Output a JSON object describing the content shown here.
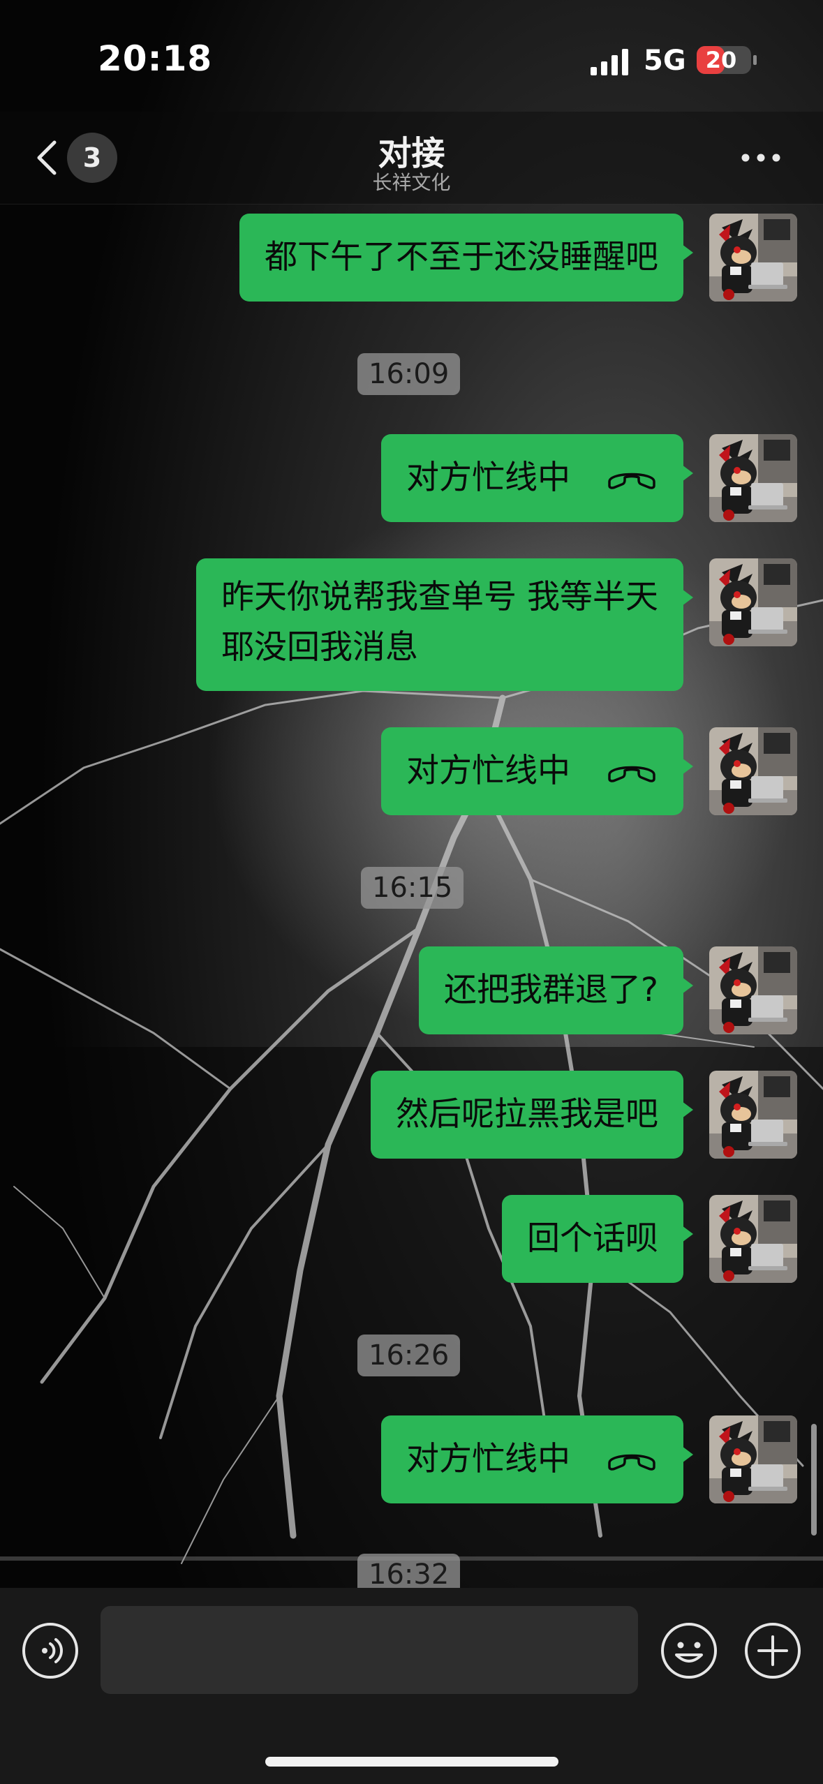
{
  "status_bar": {
    "time": "20:18",
    "network": "5G",
    "battery": "20",
    "battery_level": 0.2,
    "battery_color": "#e94040"
  },
  "header": {
    "back_icon": "chevron-left-icon",
    "unread_count": "3",
    "title": "对接",
    "subtitle": "长祥文化",
    "more_icon": "ellipsis-icon"
  },
  "theme": {
    "bubble_color": "#2bb757",
    "timestamp_bg": "#969696"
  },
  "messages": [
    {
      "type": "text",
      "text": "都下午了不至于还没睡醒吧"
    },
    {
      "type": "timestamp",
      "text": "16:09"
    },
    {
      "type": "call",
      "text": "对方忙线中",
      "icon": "phone-hangup-icon"
    },
    {
      "type": "text",
      "text": "昨天你说帮我查单号 我等半天",
      "text_line2": "耶没回我消息"
    },
    {
      "type": "call",
      "text": "对方忙线中",
      "icon": "phone-hangup-icon"
    },
    {
      "type": "timestamp",
      "text": "16:15"
    },
    {
      "type": "text",
      "text": "还把我群退了?"
    },
    {
      "type": "text",
      "text": "然后呢拉黑我是吧"
    },
    {
      "type": "text",
      "text": "回个话呗"
    },
    {
      "type": "timestamp",
      "text": "16:26"
    },
    {
      "type": "call",
      "text": "对方忙线中",
      "icon": "phone-hangup-icon"
    },
    {
      "type": "timestamp",
      "text": "16:32"
    }
  ],
  "input_bar": {
    "voice_icon": "voice-icon",
    "text_value": "",
    "emoji_icon": "emoji-icon",
    "plus_icon": "plus-icon"
  }
}
